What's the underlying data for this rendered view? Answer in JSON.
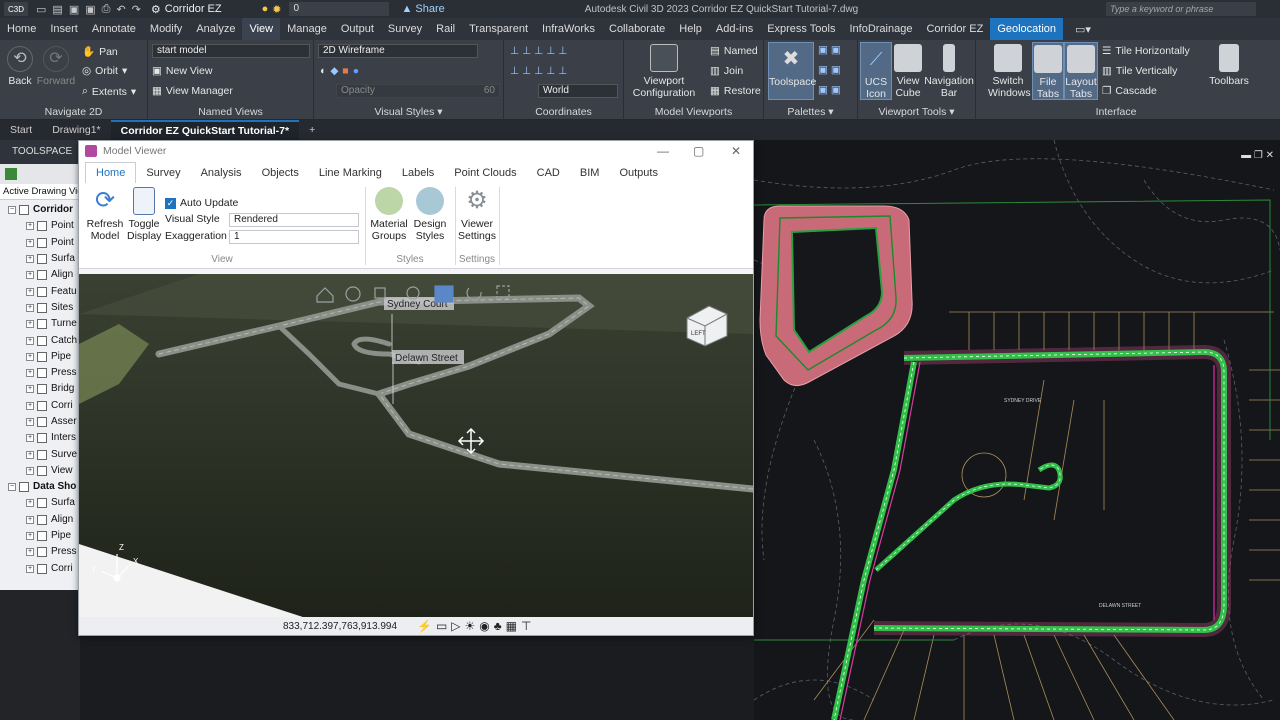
{
  "titlebar": {
    "app_logo": "C3D",
    "workspace": "Corridor EZ",
    "layer_value": "0",
    "share": "Share",
    "app_title": "Autodesk Civil 3D 2023   Corridor EZ QuickStart Tutorial-7.dwg",
    "search_placeholder": "Type a keyword or phrase"
  },
  "ribbon_tabs": [
    "Home",
    "Insert",
    "Annotate",
    "Modify",
    "Analyze",
    "View",
    "Manage",
    "Output",
    "Survey",
    "Rail",
    "Transparent",
    "InfraWorks",
    "Collaborate",
    "Help",
    "Add-ins",
    "Express Tools",
    "InfoDrainage",
    "Corridor EZ",
    "Geolocation"
  ],
  "ribbon": {
    "navigate": {
      "back": "Back",
      "forward": "Forward",
      "pan": "Pan",
      "orbit": "Orbit",
      "extents": "Extents",
      "title": "Navigate 2D"
    },
    "named_views": {
      "dropdown": "start model",
      "new_view": "New View",
      "view_manager": "View Manager",
      "title": "Named Views"
    },
    "visual_styles": {
      "dropdown": "2D Wireframe",
      "opacity": "Opacity",
      "opacity_val": "60",
      "title": "Visual Styles"
    },
    "coordinates": {
      "world": "World",
      "title": "Coordinates"
    },
    "model_viewports": {
      "config": "Viewport Configuration",
      "named": "Named",
      "join": "Join",
      "restore": "Restore",
      "title": "Model Viewports"
    },
    "palettes": {
      "toolspace": "Toolspace",
      "title": "Palettes"
    },
    "viewport_tools": {
      "ucs": "UCS Icon",
      "viewcube": "View Cube",
      "navbar": "Navigation Bar",
      "title": "Viewport Tools"
    },
    "interface": {
      "switch": "Switch Windows",
      "file_tabs": "File Tabs",
      "layout_tabs": "Layout Tabs",
      "tile_h": "Tile Horizontally",
      "tile_v": "Tile Vertically",
      "cascade": "Cascade",
      "toolbars": "Toolbars",
      "title": "Interface"
    }
  },
  "doc_tabs": [
    "Start",
    "Drawing1*",
    "Corridor EZ QuickStart Tutorial-7*",
    "+"
  ],
  "toolspace": {
    "title": "TOOLSPACE",
    "subtitle": "Active Drawing View",
    "items": [
      {
        "label": "Corridor",
        "level": 0
      },
      {
        "label": "Point",
        "level": 1
      },
      {
        "label": "Point",
        "level": 1
      },
      {
        "label": "Surfa",
        "level": 1
      },
      {
        "label": "Align",
        "level": 1
      },
      {
        "label": "Featu",
        "level": 1
      },
      {
        "label": "Sites",
        "level": 1
      },
      {
        "label": "Turne",
        "level": 1
      },
      {
        "label": "Catch",
        "level": 1
      },
      {
        "label": "Pipe",
        "level": 1
      },
      {
        "label": "Press",
        "level": 1
      },
      {
        "label": "Bridg",
        "level": 1
      },
      {
        "label": "Corri",
        "level": 1
      },
      {
        "label": "Asser",
        "level": 1
      },
      {
        "label": "Inters",
        "level": 1
      },
      {
        "label": "Surve",
        "level": 1
      },
      {
        "label": "View",
        "level": 1
      },
      {
        "label": "Data Sho",
        "level": 0
      },
      {
        "label": "Surfa",
        "level": 1
      },
      {
        "label": "Align",
        "level": 1
      },
      {
        "label": "Pipe",
        "level": 1
      },
      {
        "label": "Press",
        "level": 1
      },
      {
        "label": "Corri",
        "level": 1
      }
    ]
  },
  "model_viewer": {
    "title": "Model Viewer",
    "tabs": [
      "Home",
      "Survey",
      "Analysis",
      "Objects",
      "Line Marking",
      "Labels",
      "Point Clouds",
      "CAD",
      "BIM",
      "Outputs"
    ],
    "refresh": "Refresh Model",
    "toggle": "Toggle Display",
    "auto_update": "Auto Update",
    "visual_style_label": "Visual Style",
    "visual_style_value": "Rendered",
    "exaggeration_label": "Exaggeration",
    "exaggeration_value": "1",
    "view_group": "View",
    "material_groups": "Material Groups",
    "design_styles": "Design Styles",
    "styles_group": "Styles",
    "viewer_settings": "Viewer Settings",
    "settings_group": "Settings",
    "label_sydney": "Sydney Court",
    "label_delawn": "Delawn Street",
    "viewcube_label": "LEFT",
    "coords": "833,712.397,763,913.994"
  },
  "plan": {
    "label_sydney": "SYDNEY DRIVE",
    "label_delawn": "DELAWN STREET"
  }
}
